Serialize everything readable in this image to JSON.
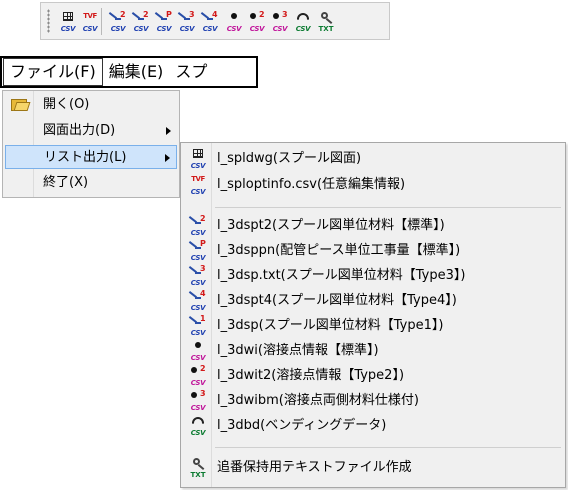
{
  "toolbar": {
    "icons": [
      {
        "name": "csv-table-icon",
        "tag": "CSV"
      },
      {
        "name": "csv-tvf-icon",
        "tag": "CSV",
        "top": "TVF"
      },
      {
        "name": "spool-material-2-icon",
        "tag": "CSV",
        "num": "2"
      },
      {
        "name": "spool-material-2b-icon",
        "tag": "CSV",
        "num": "2"
      },
      {
        "name": "spool-piece-p-icon",
        "tag": "CSV",
        "num": "P"
      },
      {
        "name": "spool-material-3-icon",
        "tag": "CSV",
        "num": "3"
      },
      {
        "name": "spool-material-4-icon",
        "tag": "CSV",
        "num": "4"
      },
      {
        "name": "weld-point-icon",
        "tag": "CSV"
      },
      {
        "name": "weld-point-2-icon",
        "tag": "CSV",
        "num": "2"
      },
      {
        "name": "weld-point-3-icon",
        "tag": "CSV",
        "num": "3"
      },
      {
        "name": "bending-icon",
        "tag": "CSV"
      },
      {
        "name": "text-file-icon",
        "tag": "TXT"
      }
    ]
  },
  "menubar": {
    "file": "ファイル(F)",
    "edit": "編集(E)",
    "spool": "スプ"
  },
  "file_menu": {
    "open": "開く(O)",
    "drawing_output": "図面出力(D)",
    "list_output": "リスト出力(L)",
    "exit": "終了(X)"
  },
  "list_menu": {
    "items": [
      "l_spldwg(スプール図面)",
      "l_sploptinfo.csv(任意編集情報)",
      "l_3dspt2(スプール図単位材料【標準】)",
      "l_3dsppn(配管ピース単位工事量【標準】)",
      "l_3dsp.txt(スプール図単位材料【Type3】)",
      "l_3dspt4(スプール図単位材料【Type4】)",
      "l_3dsp(スプール図単位材料【Type1】)",
      "l_3dwi(溶接点情報【標準】)",
      "l_3dwit2(溶接点情報【Type2】)",
      "l_3dwibm(溶接点両側材料仕様付)",
      "l_3dbd(ベンディングデータ)",
      "追番保持用テキストファイル作成"
    ],
    "icon_tags": {
      "csv": "CSV",
      "txt": "TXT",
      "tvf": "TVF",
      "n2": "2",
      "nP": "P",
      "n3": "3",
      "n4": "4",
      "n1": "1"
    }
  }
}
